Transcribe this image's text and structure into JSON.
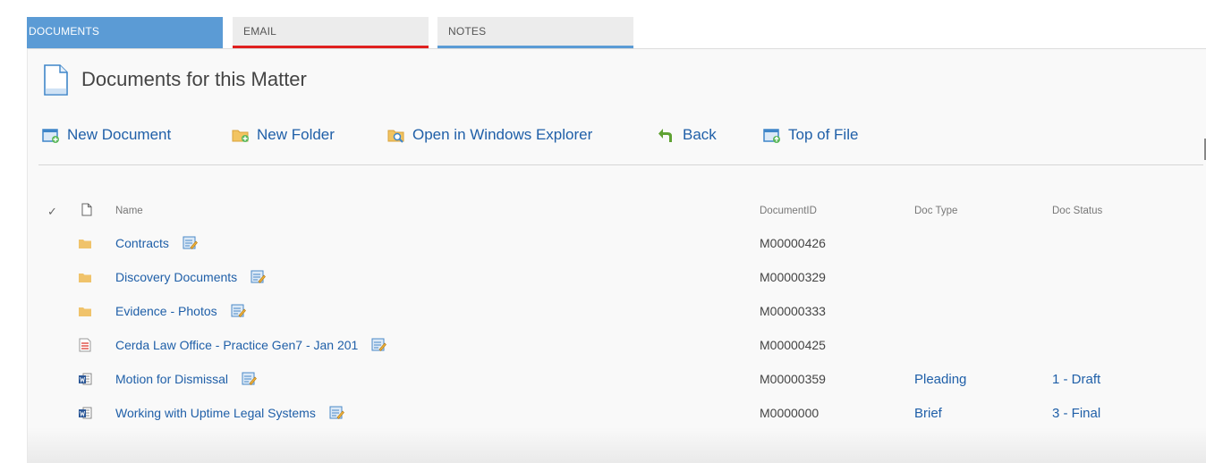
{
  "tabs": [
    {
      "label": "DOCUMENTS"
    },
    {
      "label": "EMAIL"
    },
    {
      "label": "NOTES"
    }
  ],
  "page": {
    "title": "Documents for this Matter"
  },
  "toolbar": {
    "new_document": "New Document",
    "new_folder": "New Folder",
    "open_explorer": "Open in Windows Explorer",
    "back": "Back",
    "top_of_file": "Top of File"
  },
  "list": {
    "columns": {
      "check": "✓",
      "name": "Name",
      "document_id": "DocumentID",
      "doc_type": "Doc Type",
      "doc_status": "Doc Status"
    },
    "rows": [
      {
        "icon": "folder-icon",
        "name": "Contracts",
        "document_id": "M00000426",
        "doc_type": "",
        "doc_status": ""
      },
      {
        "icon": "folder-icon",
        "name": "Discovery Documents",
        "document_id": "M00000329",
        "doc_type": "",
        "doc_status": ""
      },
      {
        "icon": "folder-icon",
        "name": "Evidence - Photos",
        "document_id": "M00000333",
        "doc_type": "",
        "doc_status": ""
      },
      {
        "icon": "pdf-icon",
        "name": "Cerda Law Office - Practice Gen7 - Jan 201",
        "document_id": "M00000425",
        "doc_type": "",
        "doc_status": ""
      },
      {
        "icon": "word-icon",
        "name": "Motion for Dismissal",
        "document_id": "M00000359",
        "doc_type": "Pleading",
        "doc_status": "1 - Draft"
      },
      {
        "icon": "word-icon",
        "name": "Working with Uptime Legal Systems",
        "document_id": "M0000000",
        "doc_type": "Brief",
        "doc_status": "3 - Final"
      }
    ]
  },
  "colors": {
    "tab_active": "#5b9bd5",
    "email_accent": "#e0201f",
    "notes_accent": "#5b9bd5",
    "link": "#1f5fa8"
  }
}
